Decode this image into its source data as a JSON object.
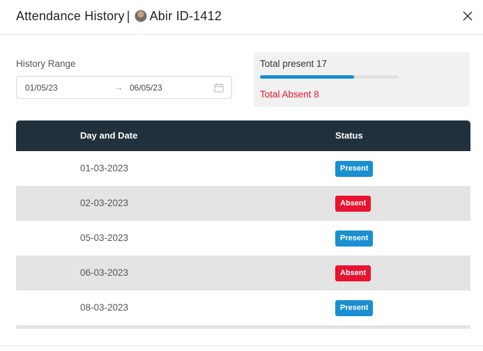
{
  "header": {
    "title": "Attendance History",
    "separator": "|",
    "user_name": "Abir ID-1412",
    "avatar_icon": "user-avatar",
    "close_icon": "close-icon"
  },
  "filter": {
    "label": "History Range",
    "start_date": "01/05/23",
    "arrow": "→",
    "end_date": "06/05/23",
    "calendar_icon": "calendar-icon"
  },
  "summary": {
    "present_label": "Total present 17",
    "present_fraction": 0.68,
    "absent_label": "Total Absent 8"
  },
  "table": {
    "headers": {
      "date": "Day and Date",
      "status": "Status"
    },
    "rows": [
      {
        "date": "01-03-2023",
        "status": "Present"
      },
      {
        "date": "02-03-2023",
        "status": "Absent"
      },
      {
        "date": "05-03-2023",
        "status": "Present"
      },
      {
        "date": "06-03-2023",
        "status": "Absent"
      },
      {
        "date": "08-03-2023",
        "status": "Present"
      }
    ]
  },
  "colors": {
    "header_bg": "#20303c",
    "present": "#1a8fd1",
    "absent": "#e8132f",
    "alt_row": "#e4e4e4"
  }
}
